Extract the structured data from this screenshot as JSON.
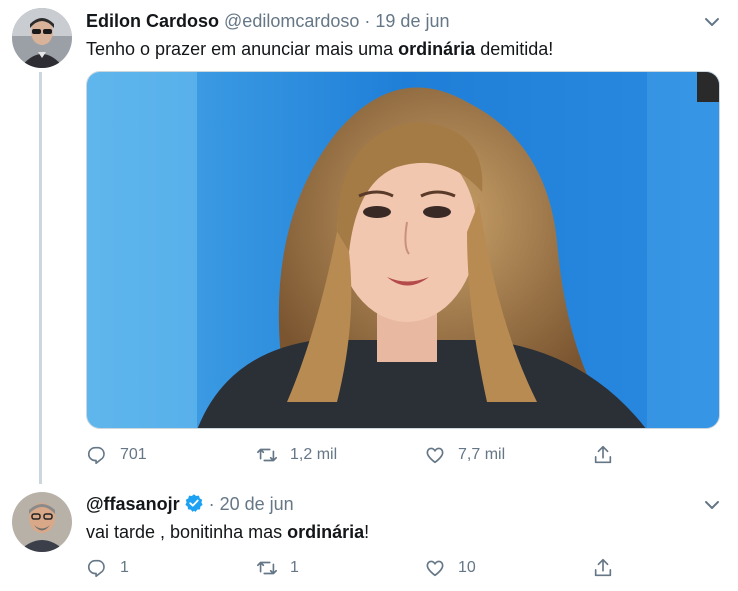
{
  "tweets": [
    {
      "author_name": "Edilon Cardoso",
      "handle": "@edilomcardoso",
      "separator": "·",
      "date": "19 de jun",
      "text_before": "Tenho o prazer em anunciar mais uma ",
      "text_bold": "ordinária",
      "text_after": " demitida!",
      "replies": "701",
      "retweets": "1,2 mil",
      "likes": "7,7 mil"
    },
    {
      "handle": "@ffasanojr",
      "separator": "·",
      "date": "20 de jun",
      "text_before": "vai tarde , bonitinha mas ",
      "text_bold": "ordinária",
      "text_after": "!",
      "replies": "1",
      "retweets": "1",
      "likes": "10"
    }
  ],
  "icons": {
    "reply": "reply-icon",
    "retweet": "retweet-icon",
    "like": "like-icon",
    "share": "share-icon",
    "menu": "chevron-down-icon",
    "verified": "verified-badge-icon"
  },
  "colors": {
    "text_primary": "#14171a",
    "text_secondary": "#657786",
    "verified": "#1da1f2",
    "thread_line": "#ccd6dd"
  }
}
